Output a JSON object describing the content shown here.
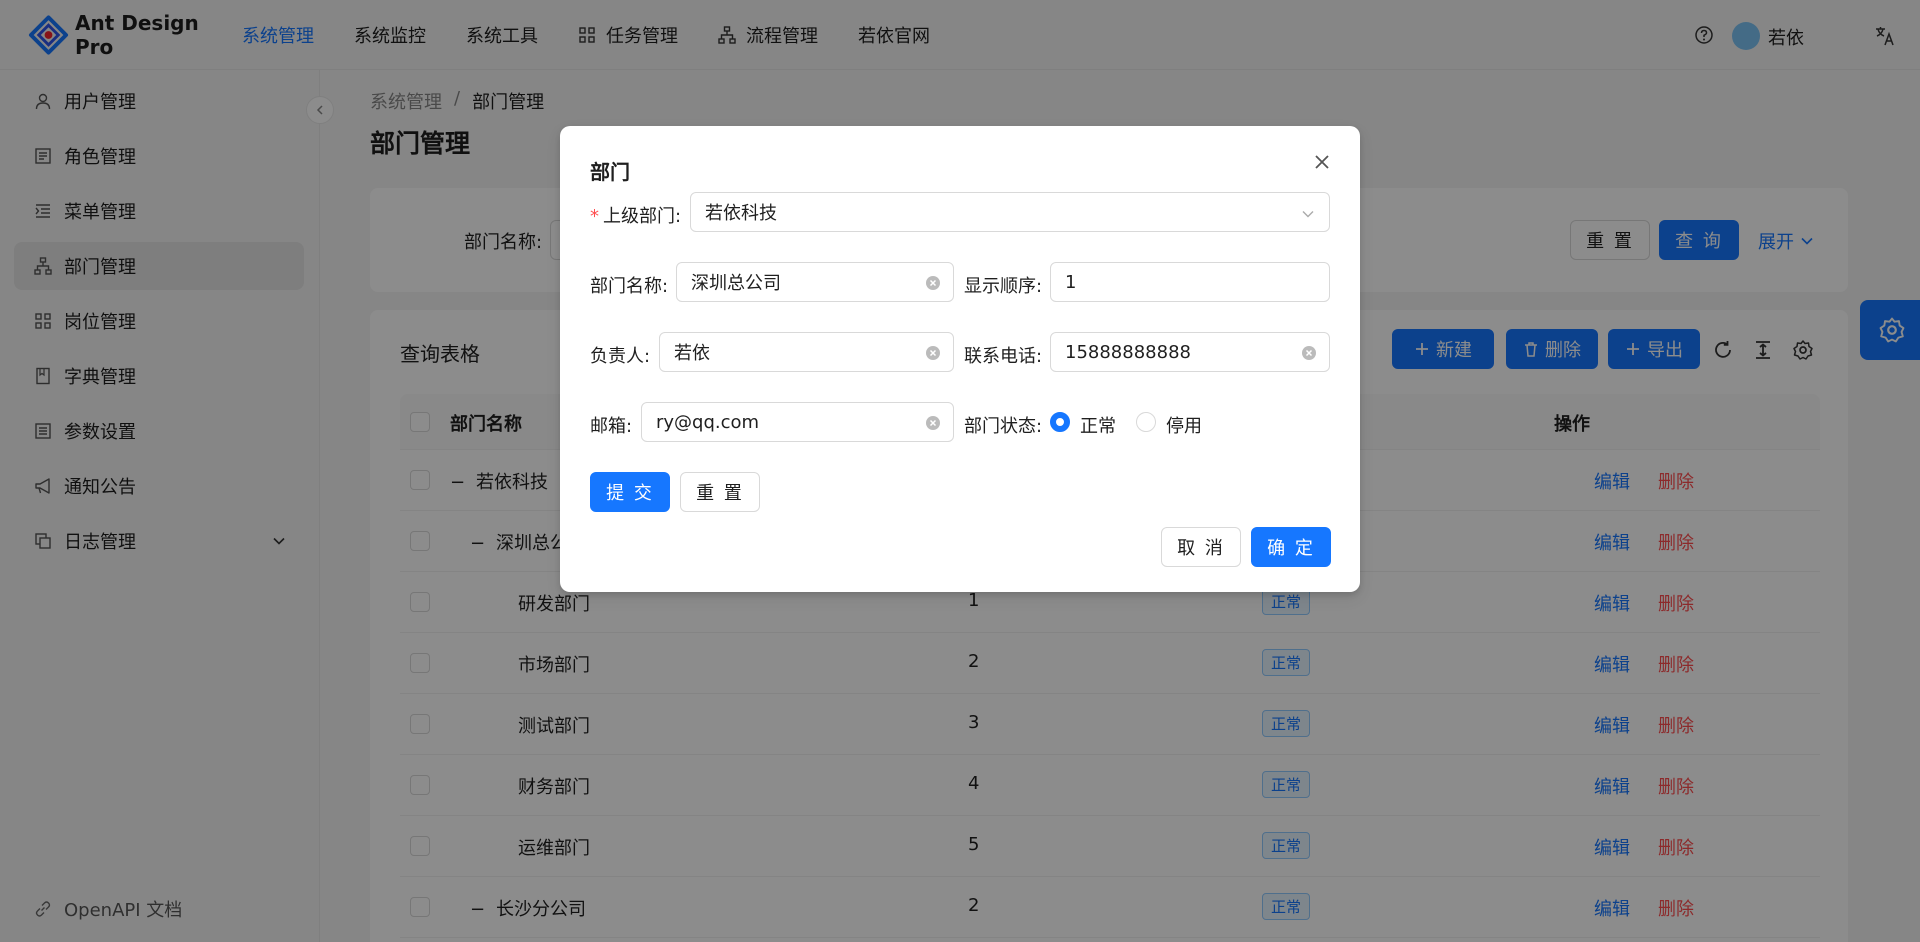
{
  "header": {
    "app_name": "Ant Design Pro",
    "nav": [
      {
        "label": "系统管理",
        "active": true
      },
      {
        "label": "系统监控",
        "active": false
      },
      {
        "label": "系统工具",
        "active": false
      },
      {
        "label": "任务管理",
        "icon": "grid-icon",
        "active": false
      },
      {
        "label": "流程管理",
        "icon": "hierarchy-icon",
        "active": false
      },
      {
        "label": "若依官网",
        "active": false
      }
    ],
    "user_name": "若依"
  },
  "sidebar": {
    "items": [
      {
        "label": "用户管理",
        "icon": "user-icon"
      },
      {
        "label": "角色管理",
        "icon": "id-card-icon"
      },
      {
        "label": "菜单管理",
        "icon": "menu-list-icon"
      },
      {
        "label": "部门管理",
        "icon": "hierarchy-icon",
        "active": true
      },
      {
        "label": "岗位管理",
        "icon": "grid-icon"
      },
      {
        "label": "字典管理",
        "icon": "book-icon"
      },
      {
        "label": "参数设置",
        "icon": "config-icon"
      },
      {
        "label": "通知公告",
        "icon": "megaphone-icon"
      },
      {
        "label": "日志管理",
        "icon": "log-icon",
        "has_children": true
      }
    ],
    "footer_link": "OpenAPI 文档"
  },
  "breadcrumb": [
    "系统管理",
    "部门管理"
  ],
  "page_title": "部门管理",
  "search": {
    "label": "部门名称:",
    "reset_label": "重 置",
    "query_label": "查 询",
    "expand_label": "展开"
  },
  "table": {
    "title": "查询表格",
    "toolbar": {
      "new_label": "新建",
      "delete_label": "删除",
      "export_label": "导出"
    },
    "headers": {
      "name": "部门名称",
      "action": "操作"
    },
    "rows": [
      {
        "name": "若依科技",
        "order": "",
        "status": "",
        "level": 0,
        "expanded": true
      },
      {
        "name": "深圳总公",
        "order": "",
        "status": "",
        "level": 1,
        "expanded": true
      },
      {
        "name": "研发部门",
        "order": "1",
        "status": "正常",
        "level": 2
      },
      {
        "name": "市场部门",
        "order": "2",
        "status": "正常",
        "level": 2
      },
      {
        "name": "测试部门",
        "order": "3",
        "status": "正常",
        "level": 2
      },
      {
        "name": "财务部门",
        "order": "4",
        "status": "正常",
        "level": 2
      },
      {
        "name": "运维部门",
        "order": "5",
        "status": "正常",
        "level": 2
      },
      {
        "name": "长沙分公司",
        "order": "2",
        "status": "正常",
        "level": 1,
        "expanded": true
      }
    ],
    "edit_label": "编辑",
    "delete_label": "删除"
  },
  "modal": {
    "title": "部门",
    "parent_label": "上级部门:",
    "parent_value": "若依科技",
    "name_label": "部门名称:",
    "name_value": "深圳总公司",
    "order_label": "显示顺序:",
    "order_value": "1",
    "leader_label": "负责人:",
    "leader_value": "若依",
    "phone_label": "联系电话:",
    "phone_value": "15888888888",
    "email_label": "邮箱:",
    "email_value": "ry@qq.com",
    "status_label": "部门状态:",
    "status_options": [
      "正常",
      "停用"
    ],
    "status_selected": "正常",
    "submit_label": "提 交",
    "reset_label": "重 置",
    "cancel_label": "取 消",
    "ok_label": "确 定"
  },
  "colors": {
    "primary": "#1677ff",
    "danger": "#ff4d4f"
  }
}
